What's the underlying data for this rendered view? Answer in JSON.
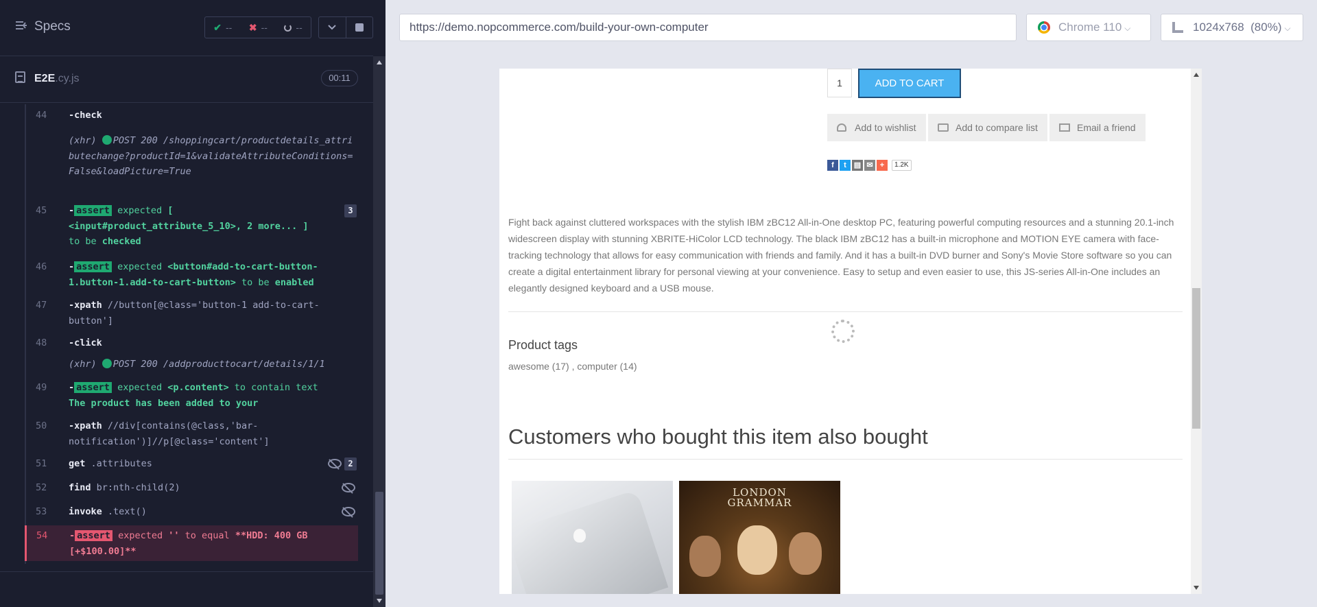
{
  "reporter": {
    "specs_label": "Specs",
    "stats": {
      "passed": "--",
      "failed": "--",
      "pending": "--"
    },
    "file": {
      "name": "E2E",
      "ext": ".cy.js",
      "duration": "00:11"
    },
    "commands": [
      {
        "num": "44",
        "name": "-check"
      },
      {
        "xhr_prefix": "(xhr)",
        "xhr_text": "POST 200 /shoppingcart/productdetails_attributechange?productId=1&validateAttributeConditions=False&loadPicture=True"
      },
      {
        "num": "45",
        "badge": "assert",
        "parts": [
          "expected",
          "[",
          "<input#product_attribute_5_10>, 2 more... ]",
          "to be",
          "checked"
        ],
        "count": "3"
      },
      {
        "num": "46",
        "badge": "assert",
        "parts": [
          "expected",
          "<button#add-to-cart-button-1.button-1.add-to-cart-button>",
          "to be",
          "enabled"
        ]
      },
      {
        "num": "47",
        "name": "-xpath",
        "message": "//button[@class='button-1 add-to-cart-button']"
      },
      {
        "num": "48",
        "name": "-click"
      },
      {
        "xhr_prefix": "(xhr)",
        "xhr_text": "POST 200 /addproducttocart/details/1/1"
      },
      {
        "num": "49",
        "badge": "assert",
        "parts": [
          "expected",
          "<p.content>",
          "to contain text",
          "The product has been added to your"
        ]
      },
      {
        "num": "50",
        "name": "-xpath",
        "message": "//div[contains(@class,'bar-notification')]//p[@class='content']"
      },
      {
        "num": "51",
        "name": "get",
        "message": ".attributes",
        "count": "2"
      },
      {
        "num": "52",
        "name": "find",
        "message": "br:nth-child(2)"
      },
      {
        "num": "53",
        "name": "invoke",
        "message": ".text()"
      },
      {
        "num": "54",
        "badge": "assert",
        "parts": [
          "expected",
          "''",
          "to equal",
          "**HDD: 400 GB [+$100.00]**"
        ]
      }
    ]
  },
  "aut": {
    "url": "https://demo.nopcommerce.com/build-your-own-computer",
    "browser": "Chrome 110",
    "viewport": "1024x768",
    "scale": "(80%)"
  },
  "page": {
    "qty": "1",
    "add_to_cart": "ADD TO CART",
    "wishlist": "Add to wishlist",
    "compare": "Add to compare list",
    "email": "Email a friend",
    "share_count": "1.2K",
    "description": "Fight back against cluttered workspaces with the stylish IBM zBC12 All-in-One desktop PC, featuring powerful computing resources and a stunning 20.1-inch widescreen display with stunning XBRITE-HiColor LCD technology. The black IBM zBC12 has a built-in microphone and MOTION EYE camera with face-tracking technology that allows for easy communication with friends and family. And it has a built-in DVD burner and Sony's Movie Store software so you can create a digital entertainment library for personal viewing at your convenience. Easy to setup and even easier to use, this JS-series All-in-One includes an elegantly designed keyboard and a USB mouse.",
    "tags_title": "Product tags",
    "tags": "awesome (17) , computer (14)",
    "also_bought": "Customers who bought this item also bought",
    "album_title_1": "LONDON",
    "album_title_2": "GRAMMAR"
  }
}
